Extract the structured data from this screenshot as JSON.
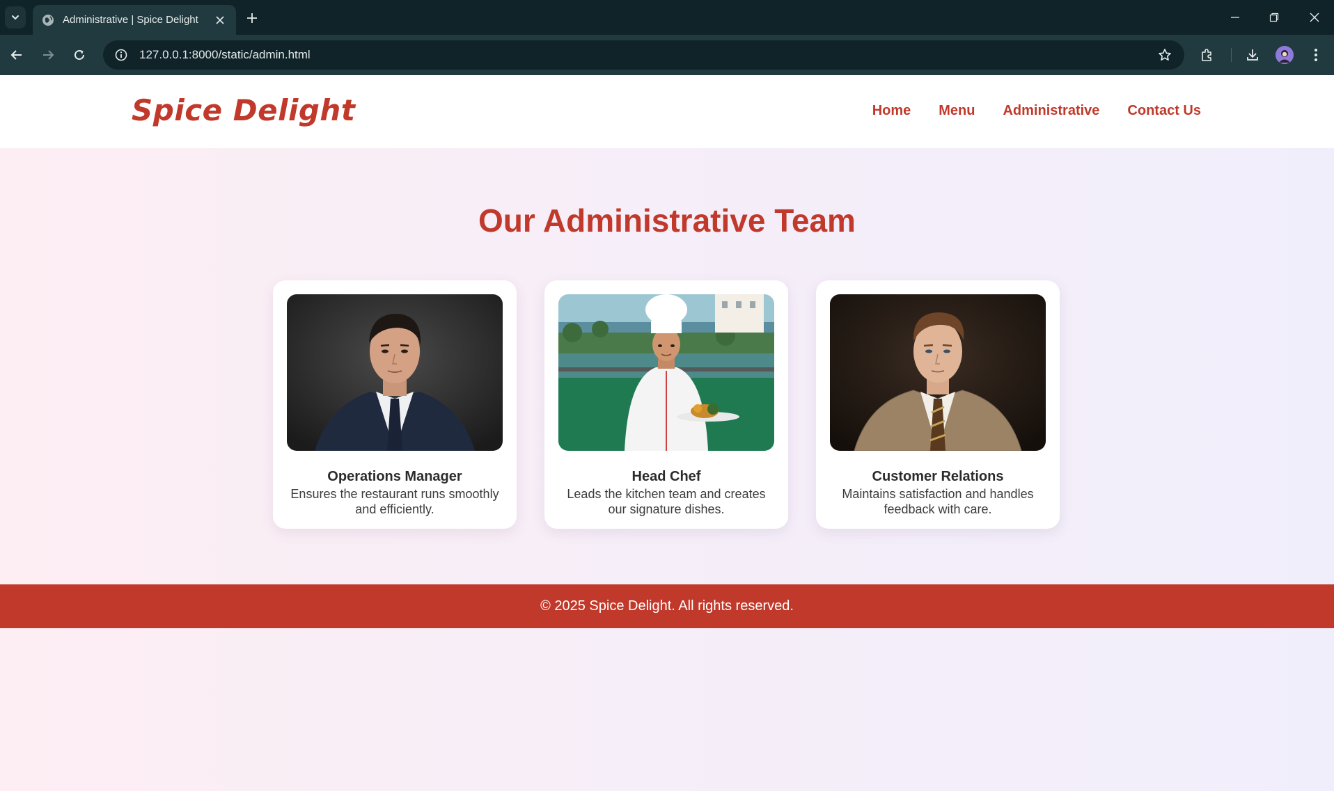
{
  "browser": {
    "tab_title": "Administrative | Spice Delight",
    "url": "127.0.0.1:8000/static/admin.html"
  },
  "site": {
    "logo": "Spice Delight",
    "nav": [
      {
        "label": "Home"
      },
      {
        "label": "Menu"
      },
      {
        "label": "Administrative"
      },
      {
        "label": "Contact Us"
      }
    ]
  },
  "main": {
    "title": "Our Administrative Team",
    "cards": [
      {
        "role": "Operations Manager",
        "desc": "Ensures the restaurant runs smoothly and efficiently."
      },
      {
        "role": "Head Chef",
        "desc": "Leads the kitchen team and creates our signature dishes."
      },
      {
        "role": "Customer Relations",
        "desc": "Maintains satisfaction and handles feedback with care."
      }
    ]
  },
  "footer": {
    "text": "© 2025 Spice Delight. All rights reserved."
  },
  "colors": {
    "brand": "#c0392b",
    "chrome_dark": "#0f2328",
    "chrome_toolbar": "#213a40"
  }
}
